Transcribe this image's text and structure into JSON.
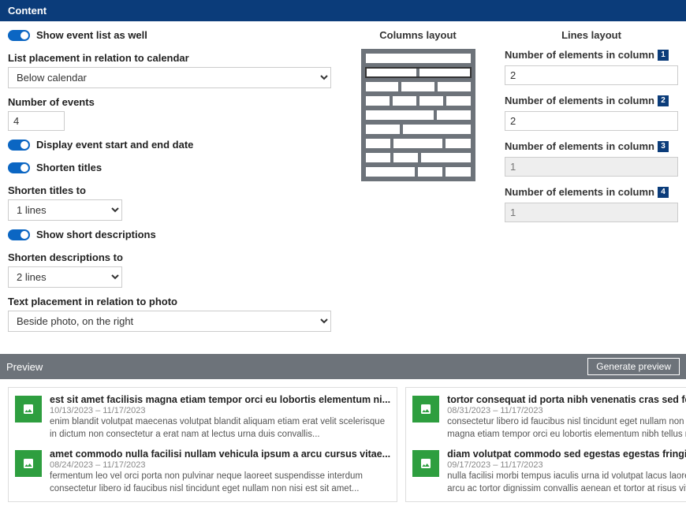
{
  "header": {
    "title": "Content"
  },
  "form": {
    "show_event_list": "Show event list as well",
    "list_placement_label": "List placement in relation to calendar",
    "list_placement_value": "Below calendar",
    "num_events_label": "Number of events",
    "num_events_value": "4",
    "display_dates": "Display event start and end date",
    "shorten_titles": "Shorten titles",
    "shorten_titles_to_label": "Shorten titles to",
    "shorten_titles_to_value": "1 lines",
    "show_short_desc": "Show short descriptions",
    "shorten_desc_to_label": "Shorten descriptions to",
    "shorten_desc_to_value": "2 lines",
    "text_placement_label": "Text placement in relation to photo",
    "text_placement_value": "Beside photo, on the right"
  },
  "columns_layout_title": "Columns layout",
  "lines_layout_title": "Lines layout",
  "lines": [
    {
      "label": "Number of elements in column",
      "num": "1",
      "value": "2",
      "readonly": false
    },
    {
      "label": "Number of elements in column",
      "num": "2",
      "value": "2",
      "readonly": false
    },
    {
      "label": "Number of elements in column",
      "num": "3",
      "value": "1",
      "readonly": true
    },
    {
      "label": "Number of elements in column",
      "num": "4",
      "value": "1",
      "readonly": true
    }
  ],
  "preview": {
    "bar_label": "Preview",
    "button": "Generate preview",
    "cols": [
      [
        {
          "title": "est sit amet facilisis magna etiam tempor orci eu lobortis elementum ni...",
          "date": "10/13/2023 – 11/17/2023",
          "desc": "enim blandit volutpat maecenas volutpat blandit aliquam etiam erat velit scelerisque in dictum non consectetur a erat nam at lectus urna duis convallis..."
        },
        {
          "title": "amet commodo nulla facilisi nullam vehicula ipsum a arcu cursus vitae...",
          "date": "08/24/2023 – 11/17/2023",
          "desc": "fermentum leo vel orci porta non pulvinar neque laoreet suspendisse interdum consectetur libero id faucibus nisl tincidunt eget nullam non nisi est sit amet..."
        }
      ],
      [
        {
          "title": "tortor consequat id porta nibh venenatis cras sed felis eget velit aliquet...",
          "date": "08/31/2023 – 11/17/2023",
          "desc": "consectetur libero id faucibus nisl tincidunt eget nullam non nisi est sit amet facilisis magna etiam tempor orci eu lobortis elementum nibh tellus molestie..."
        },
        {
          "title": "diam volutpat commodo sed egestas egestas fringilla phasellus faucibu...",
          "date": "09/17/2023 – 11/17/2023",
          "desc": "nulla facilisi morbi tempus iaculis urna id volutpat lacus laoreet non curabitur gravida arcu ac tortor dignissim convallis aenean et tortor at risus viverra..."
        }
      ]
    ]
  }
}
